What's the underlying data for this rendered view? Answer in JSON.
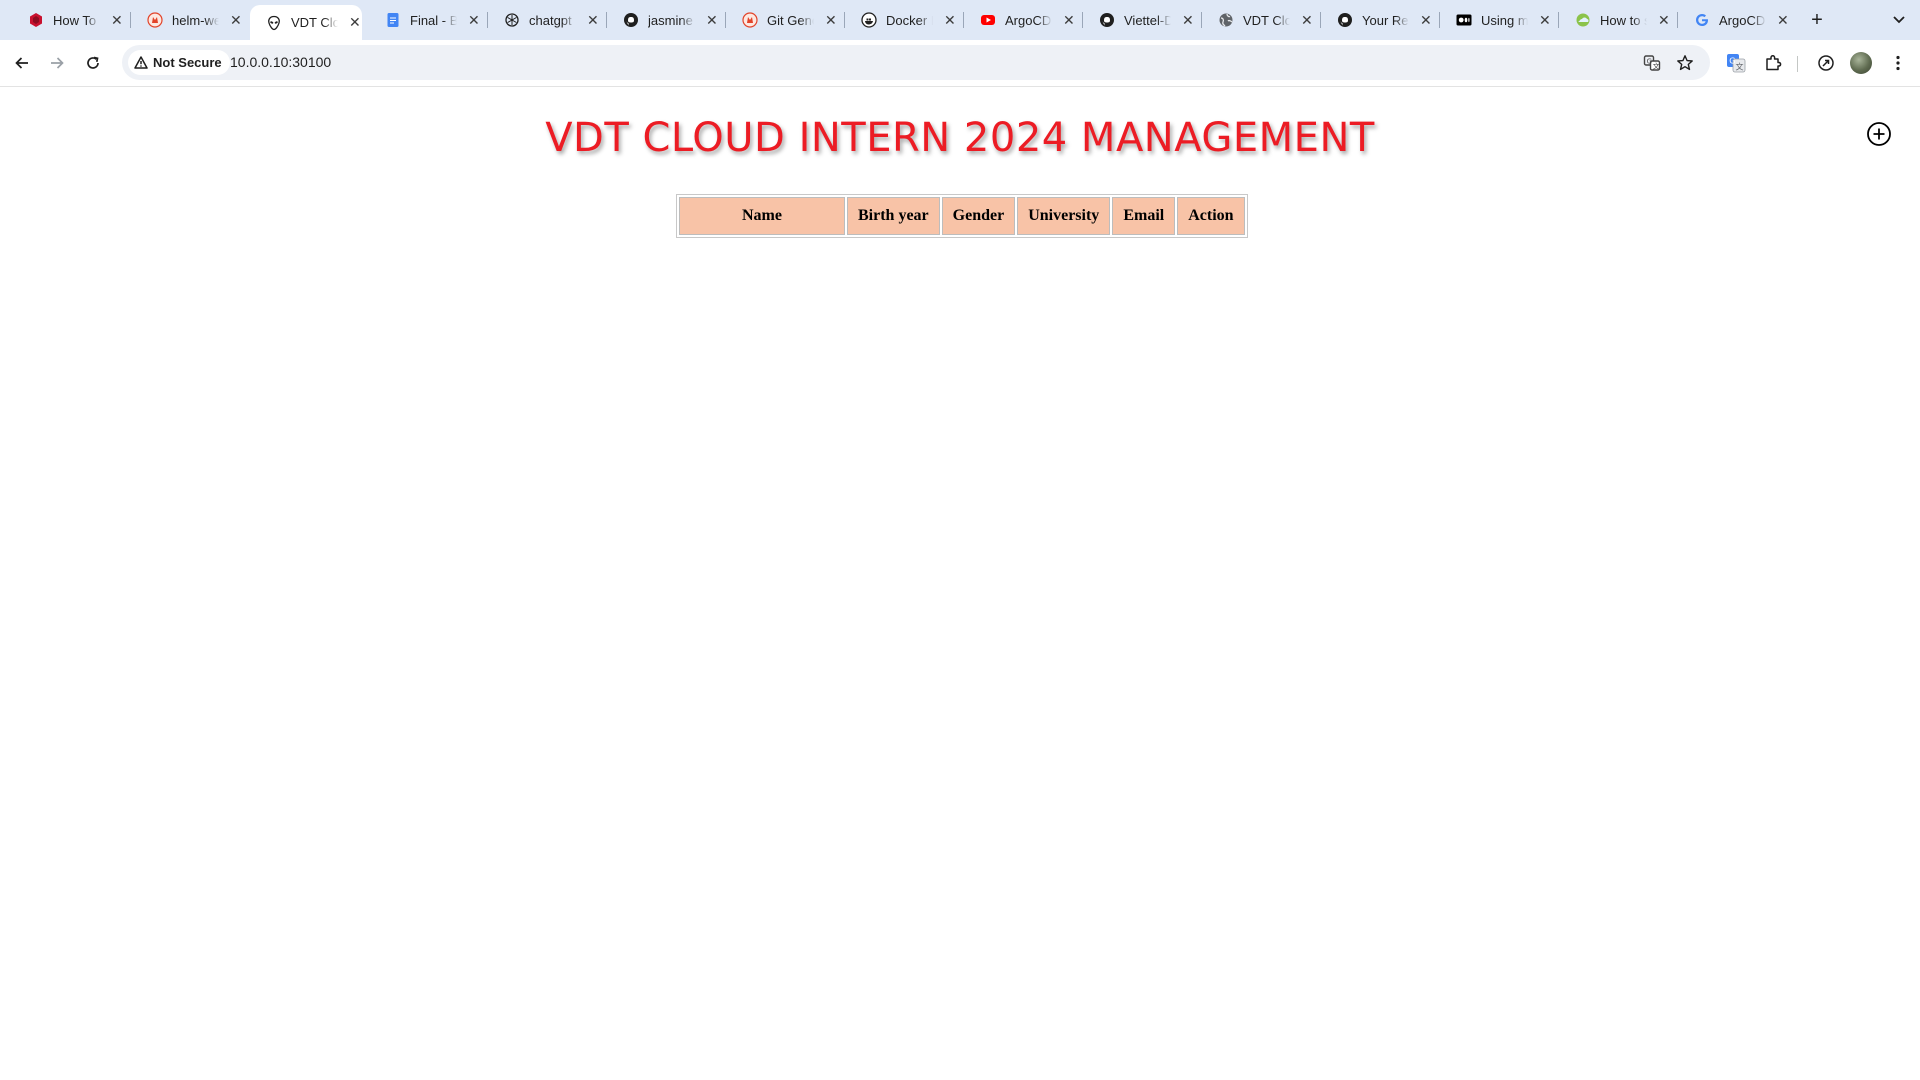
{
  "browser": {
    "tabs": [
      {
        "title": "How To I",
        "icon": "ruby-icon",
        "active": false
      },
      {
        "title": "helm-we",
        "icon": "gitlab-icon",
        "active": false
      },
      {
        "title": "VDT Clo",
        "icon": "alien-icon",
        "active": true
      },
      {
        "title": "Final - B",
        "icon": "google-docs-icon",
        "active": false
      },
      {
        "title": "chatgpt",
        "icon": "chatgpt-icon",
        "active": false
      },
      {
        "title": "jasmine",
        "icon": "github-icon",
        "active": false
      },
      {
        "title": "Git Gene",
        "icon": "gitlab-icon",
        "active": false
      },
      {
        "title": "Docker I",
        "icon": "docker-icon",
        "active": false
      },
      {
        "title": "ArgoCD",
        "icon": "youtube-icon",
        "active": false
      },
      {
        "title": "Viettel-D",
        "icon": "github-icon",
        "active": false
      },
      {
        "title": "VDT Clo",
        "icon": "globe-icon",
        "active": false
      },
      {
        "title": "Your Re",
        "icon": "github-icon",
        "active": false
      },
      {
        "title": "Using m",
        "icon": "medium-icon",
        "active": false
      },
      {
        "title": "How to s",
        "icon": "globe-cloud-icon",
        "active": false
      },
      {
        "title": "ArgoCD",
        "icon": "google-icon",
        "active": false
      }
    ],
    "security_label": "Not Secure",
    "url": "10.0.0.10:30100"
  },
  "page": {
    "title": "VDT CLOUD INTERN 2024 MANAGEMENT",
    "table": {
      "headers": [
        "Name",
        "Birth year",
        "Gender",
        "University",
        "Email",
        "Action"
      ],
      "rows": []
    }
  },
  "colors": {
    "title": "#ec1c24",
    "header_bg": "#f8c3a7",
    "tabstrip_bg": "#dfe8f6"
  }
}
